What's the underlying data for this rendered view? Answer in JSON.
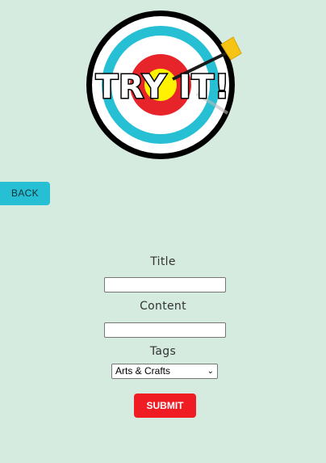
{
  "logo": {
    "text": "TRY IT!"
  },
  "nav": {
    "back_label": "BACK"
  },
  "form": {
    "title_label": "Title",
    "title_value": "",
    "content_label": "Content",
    "content_value": "",
    "tags_label": "Tags",
    "tags_selected": "Arts & Crafts",
    "submit_label": "SUBMIT"
  },
  "colors": {
    "background": "#d6ebe0",
    "accent": "#26bfd4",
    "submit": "#f01c24",
    "target_red": "#e8242b",
    "target_yellow": "#fff200"
  }
}
